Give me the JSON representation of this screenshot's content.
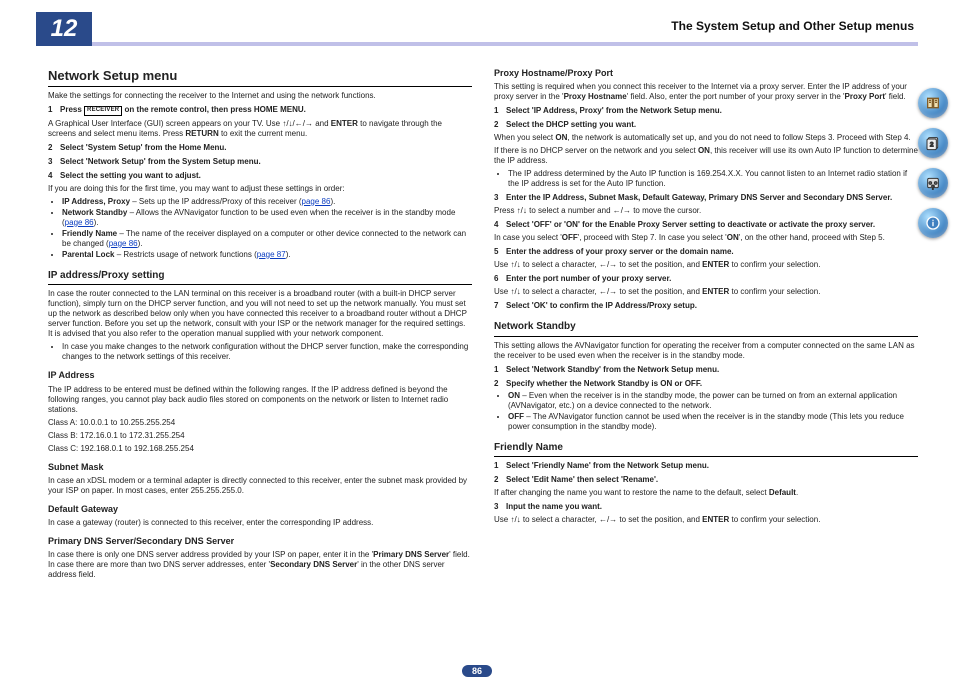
{
  "header": {
    "chapter": "12",
    "title": "The System Setup and Other Setup menus"
  },
  "page_number": "86",
  "left": {
    "h1": "Network Setup menu",
    "intro": "Make the settings for connecting the receiver to the Internet and using the network functions.",
    "step1_a": "Press ",
    "step1_b": " on the remote control, then press HOME MENU.",
    "step1_desc_a": "A Graphical User Interface (GUI) screen appears on your TV. Use ",
    "step1_desc_arrows": "↑/↓/←/→",
    "step1_desc_b": " and ",
    "step1_desc_enter": "ENTER",
    "step1_desc_c": " to navigate through the screens and select menu items. Press ",
    "step1_desc_return": "RETURN",
    "step1_desc_d": " to exit the current menu.",
    "step2": "Select 'System Setup' from the Home Menu.",
    "step3": "Select 'Network Setup' from the System Setup menu.",
    "step4": "Select the setting you want to adjust.",
    "step4_desc": "If you are doing this for the first time, you may want to adjust these settings in order:",
    "bul1_a": "IP Address, Proxy",
    "bul1_b": " – Sets up the IP address/Proxy of this receiver (",
    "bul1_link": "page 86",
    "bul1_c": ").",
    "bul2_a": "Network Standby",
    "bul2_b": " – Allows the AVNavigator function to be used even when the receiver is in the standby mode (",
    "bul2_link": "page 86",
    "bul2_c": ").",
    "bul3_a": "Friendly Name",
    "bul3_b": " – The name of the receiver displayed on a computer or other device connected to the network can be changed (",
    "bul3_link": "page 86",
    "bul3_c": ").",
    "bul4_a": "Parental Lock",
    "bul4_b": " – Restricts usage of network functions (",
    "bul4_link": "page 87",
    "bul4_c": ").",
    "h2_ip": "IP address/Proxy setting",
    "ip_p1": "In case the router connected to the LAN terminal on this receiver is a broadband router (with a built-in DHCP server function), simply turn on the DHCP server function, and you will not need to set up the network manually. You must set up the network as described below only when you have connected this receiver to a broadband router without a DHCP server function. Before you set up the network, consult with your ISP or the network manager for the required settings. It is advised that you also refer to the operation manual supplied with your network component.",
    "ip_bul": "In case you make changes to the network configuration without the DHCP server function, make the corresponding changes to the network settings of this receiver.",
    "h3_ipaddr": "IP Address",
    "ipaddr_p": "The IP address to be entered must be defined within the following ranges. If the IP address defined is beyond the following ranges, you cannot play back audio files stored on components on the network or listen to Internet radio stations.",
    "classA": "Class A: 10.0.0.1 to 10.255.255.254",
    "classB": "Class B: 172.16.0.1 to 172.31.255.254",
    "classC": "Class C: 192.168.0.1 to 192.168.255.254",
    "h3_subnet": "Subnet Mask",
    "subnet_p": "In case an xDSL modem or a terminal adapter is directly connected to this receiver, enter the subnet mask provided by your ISP on paper. In most cases, enter 255.255.255.0.",
    "h3_gw": "Default Gateway",
    "gw_p": "In case a gateway (router) is connected to this receiver, enter the corresponding IP address.",
    "h3_dns": "Primary DNS Server/Secondary DNS Server",
    "dns_p_a": "In case there is only one DNS server address provided by your ISP on paper, enter it in the '",
    "dns_p_b": "Primary DNS Server",
    "dns_p_c": "' field. In case there are more than two DNS server addresses, enter '",
    "dns_p_d": "Secondary DNS Server",
    "dns_p_e": "' in the other DNS server address field."
  },
  "right": {
    "h3_proxy": "Proxy Hostname/Proxy Port",
    "proxy_p_a": "This setting is required when you connect this receiver to the Internet via a proxy server. Enter the IP address of your proxy server in the '",
    "proxy_p_b": "Proxy Hostname",
    "proxy_p_c": "' field. Also, enter the port number of your proxy server in the '",
    "proxy_p_d": "Proxy Port",
    "proxy_p_e": "' field.",
    "pstep1": "Select 'IP Address, Proxy' from the Network Setup menu.",
    "pstep2": "Select the DHCP setting you want.",
    "pstep2_desc_a": "When you select ",
    "pstep2_on": "ON",
    "pstep2_desc_b": ", the network is automatically set up, and you do not need to follow Steps 3. Proceed with Step 4.",
    "pstep2_desc_c": "If there is no DHCP server on the network and you select ",
    "pstep2_desc_d": ", this receiver will use its own Auto IP function to determine the IP address.",
    "pstep2_bul": "The IP address determined by the Auto IP function is 169.254.X.X. You cannot listen to an Internet radio station if the IP address is set for the Auto IP function.",
    "pstep3": "Enter the IP Address, Subnet Mask, Default Gateway, Primary DNS Server and Secondary DNS Server.",
    "pstep3_desc_a": "Press ",
    "pstep3_desc_arrows1": "↑/↓",
    "pstep3_desc_b": " to select a number and ",
    "pstep3_desc_arrows2": "←/→",
    "pstep3_desc_c": " to move the cursor.",
    "pstep4": "Select 'OFF' or 'ON' for the Enable Proxy Server setting to deactivate or activate the proxy server.",
    "pstep4_desc_a": "In case you select '",
    "pstep4_off": "OFF",
    "pstep4_desc_b": "', proceed with Step 7. In case you select '",
    "pstep4_on": "ON",
    "pstep4_desc_c": "', on the other hand, proceed with Step 5.",
    "pstep5": "Enter the address of your proxy server or the domain name.",
    "pstep5_desc_a": "Use ",
    "pstep5_desc_arrows1": "↑/↓",
    "pstep5_desc_b": " to select a character, ",
    "pstep5_desc_arrows2": "←/→",
    "pstep5_desc_c": " to set the position, and ",
    "pstep5_enter": "ENTER",
    "pstep5_desc_d": " to confirm your selection.",
    "pstep6": "Enter the port number of your proxy server.",
    "pstep6_desc_a": "Use ",
    "pstep6_desc_b": " to select a character, ",
    "pstep6_desc_c": " to set the position, and ",
    "pstep6_desc_d": " to confirm your selection.",
    "pstep7": "Select 'OK' to confirm the IP Address/Proxy setup.",
    "h2_standby": "Network Standby",
    "standby_p": "This setting allows the AVNavigator function for operating the receiver from a computer connected on the same LAN as the receiver to be used even when the receiver is in the standby mode.",
    "sstep1": "Select 'Network Standby' from the Network Setup menu.",
    "sstep2": "Specify whether the Network Standby is ON or OFF.",
    "sb1_a": "ON",
    "sb1_b": " – Even when the receiver is in the standby mode, the power can be turned on from an external application (AVNavigator, etc.) on a device connected to the network.",
    "sb2_a": "OFF",
    "sb2_b": " – The AVNavigator function cannot be used when the receiver is in the standby mode (This lets you reduce power consumption in the standby mode).",
    "h2_friendly": "Friendly Name",
    "fstep1": "Select 'Friendly Name' from the Network Setup menu.",
    "fstep2": "Select 'Edit Name' then select 'Rename'.",
    "fstep2_desc_a": "If after changing the name you want to restore the name to the default, select ",
    "fstep2_default": "Default",
    "fstep2_desc_b": ".",
    "fstep3": "Input the name you want.",
    "fstep3_desc_a": "Use ",
    "fstep3_desc_b": " to select a character, ",
    "fstep3_desc_c": " to set the position, and ",
    "fstep3_desc_d": " to confirm your selection."
  }
}
